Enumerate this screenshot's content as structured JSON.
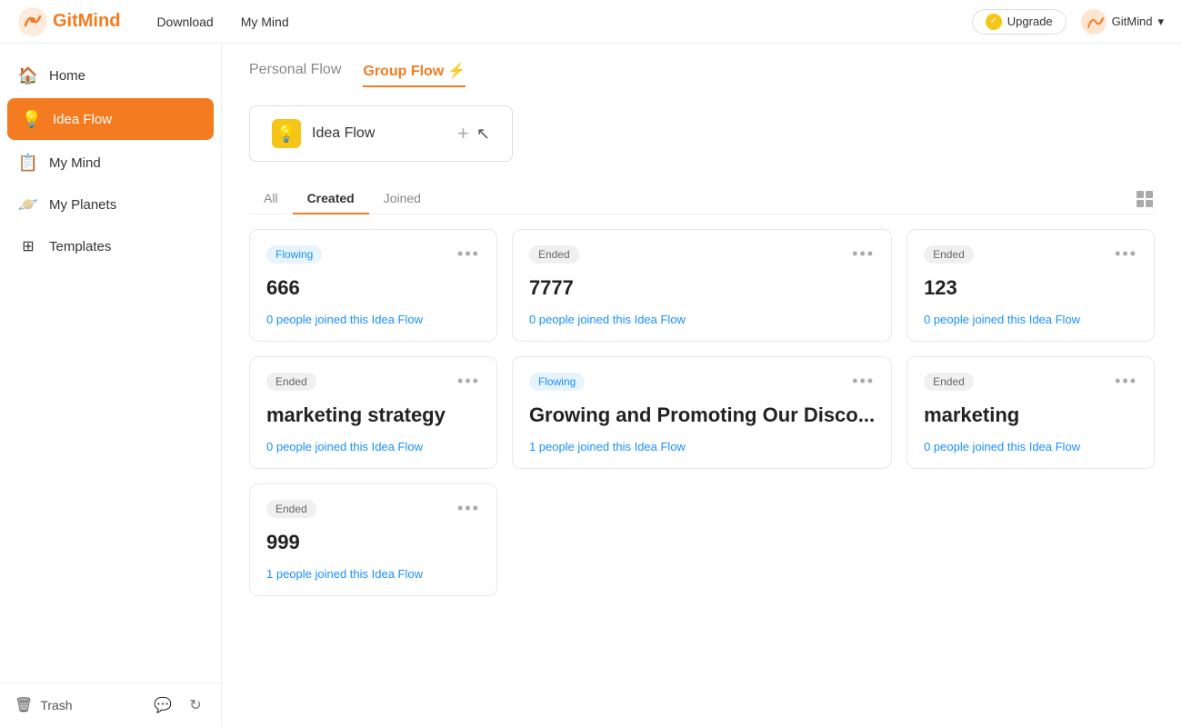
{
  "app": {
    "name": "GitMind",
    "logo_text": "GitMind"
  },
  "topnav": {
    "links": [
      {
        "id": "download",
        "label": "Download"
      },
      {
        "id": "my-mind",
        "label": "My Mind"
      }
    ],
    "upgrade_label": "Upgrade",
    "user_label": "GitMind",
    "user_dropdown": "▾"
  },
  "sidebar": {
    "items": [
      {
        "id": "home",
        "label": "Home",
        "icon": "🏠",
        "active": false
      },
      {
        "id": "idea-flow",
        "label": "Idea Flow",
        "icon": "💡",
        "active": true
      },
      {
        "id": "my-mind",
        "label": "My Mind",
        "icon": "📋",
        "active": false
      },
      {
        "id": "my-planets",
        "label": "My Planets",
        "icon": "🪐",
        "active": false
      },
      {
        "id": "templates",
        "label": "Templates",
        "icon": "⊞",
        "active": false
      }
    ],
    "trash_label": "Trash"
  },
  "main": {
    "tabs": [
      {
        "id": "personal-flow",
        "label": "Personal Flow",
        "active": false
      },
      {
        "id": "group-flow",
        "label": "Group Flow",
        "emoji": "⚡",
        "active": true
      }
    ],
    "create_card": {
      "label": "Idea Flow",
      "plus": "+"
    },
    "filter_tabs": [
      {
        "id": "all",
        "label": "All",
        "active": false
      },
      {
        "id": "created",
        "label": "Created",
        "active": true
      },
      {
        "id": "joined",
        "label": "Joined",
        "active": false
      }
    ],
    "cards": [
      {
        "id": "card-1",
        "status": "Flowing",
        "status_type": "flowing",
        "title": "666",
        "people": "0 people joined this Idea Flow"
      },
      {
        "id": "card-2",
        "status": "Ended",
        "status_type": "ended",
        "title": "7777",
        "people": "0 people joined this Idea Flow"
      },
      {
        "id": "card-3",
        "status": "Ended",
        "status_type": "ended",
        "title": "123",
        "people": "0 people joined this Idea Flow"
      },
      {
        "id": "card-4",
        "status": "Ended",
        "status_type": "ended",
        "title": "marketing strategy",
        "people": "0 people joined this Idea Flow"
      },
      {
        "id": "card-5",
        "status": "Flowing",
        "status_type": "flowing",
        "title": "Growing and Promoting Our Disco...",
        "people": "1 people joined this Idea Flow"
      },
      {
        "id": "card-6",
        "status": "Ended",
        "status_type": "ended",
        "title": "marketing",
        "people": "0 people joined this Idea Flow"
      },
      {
        "id": "card-7",
        "status": "Ended",
        "status_type": "ended",
        "title": "999",
        "people": "1 people joined this Idea Flow"
      }
    ]
  }
}
